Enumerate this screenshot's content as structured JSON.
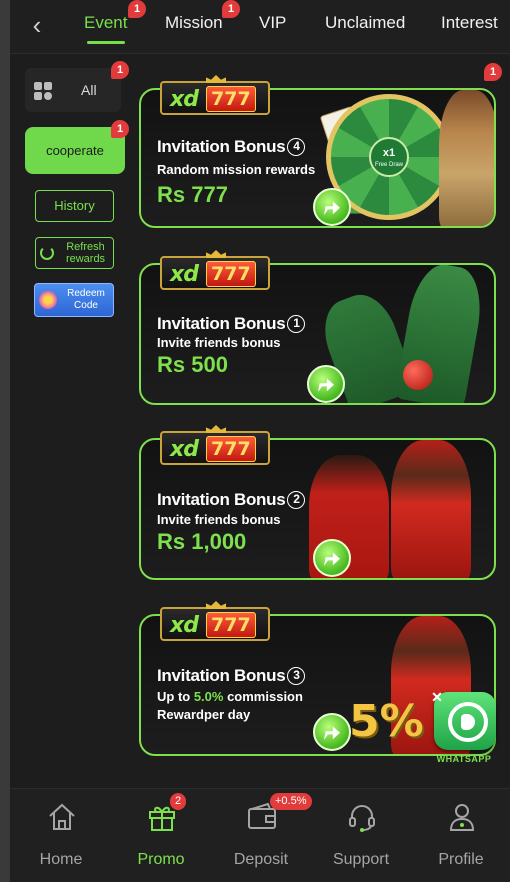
{
  "tabs": [
    {
      "label": "Event",
      "active": true,
      "badge": "1"
    },
    {
      "label": "Mission",
      "active": false,
      "badge": "1"
    },
    {
      "label": "VIP",
      "active": false,
      "badge": ""
    },
    {
      "label": "Unclaimed",
      "active": false,
      "badge": ""
    },
    {
      "label": "Interest",
      "active": false,
      "badge": ""
    }
  ],
  "filters": {
    "all": {
      "label": "All",
      "badge": "1"
    },
    "cooperate": {
      "label": "cooperate",
      "badge": "1"
    },
    "history": "History",
    "refresh": "Refresh rewards",
    "redeem": "Redeem Code"
  },
  "cards": [
    {
      "logo_prefix": "xd",
      "logo_num": "777",
      "title": "Invitation Bonus",
      "num": "4",
      "subtitle": "Random mission rewards",
      "amount": "Rs 777",
      "badge": "1",
      "wheel_center": "x1",
      "wheel_sub": "Free Draw"
    },
    {
      "logo_prefix": "xd",
      "logo_num": "777",
      "title": "Invitation Bonus",
      "num": "1",
      "subtitle": "Invite friends bonus",
      "amount": "Rs 500"
    },
    {
      "logo_prefix": "xd",
      "logo_num": "777",
      "title": "Invitation Bonus",
      "num": "2",
      "subtitle": "Invite friends bonus",
      "amount": "Rs 1,000"
    },
    {
      "logo_prefix": "xd",
      "logo_num": "777",
      "title": "Invitation Bonus",
      "num": "3",
      "subtitle_prefix": "Up to ",
      "subtitle_highlight": "5.0%",
      "subtitle_suffix": " commission",
      "subtitle2": "Rewardper day",
      "badge_art": "5%"
    }
  ],
  "whatsapp": {
    "label": "WHATSAPP",
    "close": "✕"
  },
  "bottom_nav": [
    {
      "label": "Home",
      "icon": "home-icon",
      "active": false
    },
    {
      "label": "Promo",
      "icon": "gift-icon",
      "active": true,
      "badge": "2"
    },
    {
      "label": "Deposit",
      "icon": "wallet-icon",
      "active": false,
      "badge": "+0.5%"
    },
    {
      "label": "Support",
      "icon": "headset-icon",
      "active": false
    },
    {
      "label": "Profile",
      "icon": "user-icon",
      "active": false
    }
  ],
  "colors": {
    "accent": "#7ee04d",
    "badge": "#e23b3b",
    "background": "#1d1d1d"
  }
}
